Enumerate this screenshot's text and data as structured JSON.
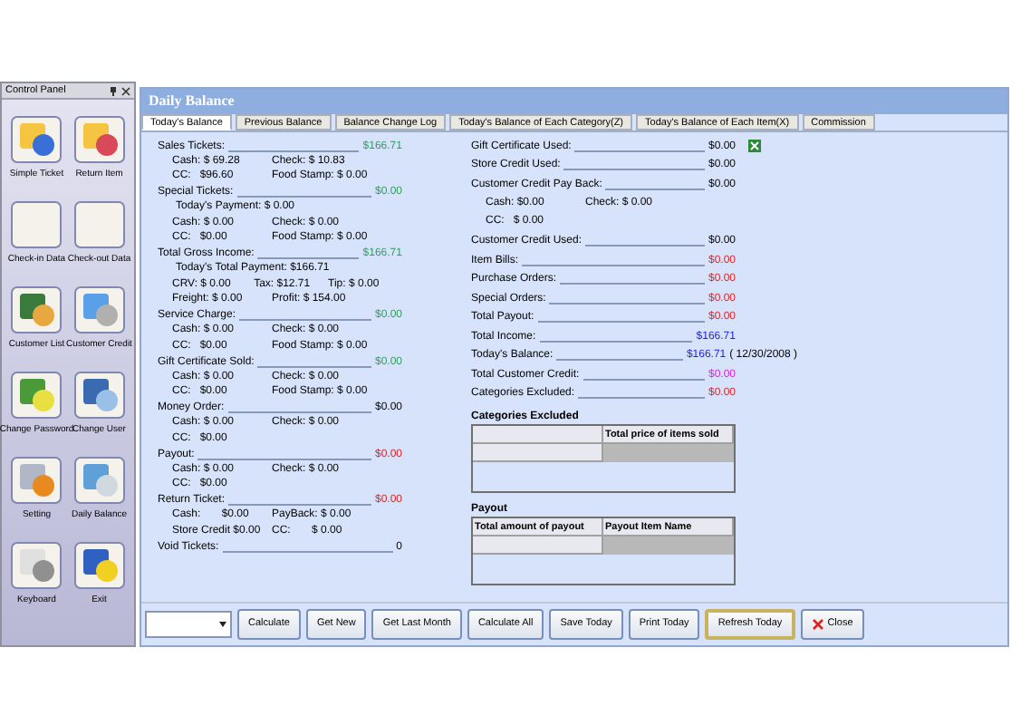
{
  "control_panel": {
    "title": "Control Panel",
    "items": [
      {
        "label": "Simple Ticket"
      },
      {
        "label": "Return Item"
      },
      {
        "label": "Check-in Data"
      },
      {
        "label": "Check-out Data"
      },
      {
        "label": "Customer List"
      },
      {
        "label": "Customer Credit"
      },
      {
        "label": "Change Password"
      },
      {
        "label": "Change User"
      },
      {
        "label": "Setting"
      },
      {
        "label": "Daily Balance"
      },
      {
        "label": "Keyboard"
      },
      {
        "label": "Exit"
      }
    ]
  },
  "window": {
    "title": "Daily Balance"
  },
  "tabs": [
    {
      "label": "Today's Balance",
      "selected": true
    },
    {
      "label": "Previous Balance",
      "selected": false
    },
    {
      "label": "Balance Change Log",
      "selected": false
    },
    {
      "label": "Today's Balance of Each Category(Z)",
      "selected": false
    },
    {
      "label": "Today's Balance of Each Item(X)",
      "selected": false
    },
    {
      "label": "Commission",
      "selected": false
    }
  ],
  "left_column": [
    {
      "kind": "total",
      "label": "Sales Tickets:",
      "value": "$166.71",
      "color": "#2e9e5a"
    },
    {
      "kind": "detail",
      "cells": [
        "Cash: $ 69.28",
        "Check: $ 10.83"
      ]
    },
    {
      "kind": "detail",
      "cells": [
        "CC:   $96.60",
        "Food Stamp: $ 0.00"
      ]
    },
    {
      "kind": "total",
      "label": "Special Tickets:",
      "value": "$0.00",
      "color": "#2e9e5a"
    },
    {
      "kind": "note",
      "text": "Today's Payment: $ 0.00"
    },
    {
      "kind": "detail",
      "cells": [
        "Cash: $ 0.00",
        "Check: $ 0.00"
      ]
    },
    {
      "kind": "detail",
      "cells": [
        "CC:   $0.00",
        "Food Stamp: $ 0.00"
      ]
    },
    {
      "kind": "total",
      "label": "Total Gross Income:",
      "value": "$166.71",
      "color": "#2e9e5a"
    },
    {
      "kind": "note",
      "text": "Today's Total Payment: $166.71"
    },
    {
      "kind": "detail",
      "cells": [
        "CRV: $ 0.00",
        "Tax: $12.71",
        "Tip: $ 0.00"
      ]
    },
    {
      "kind": "detail",
      "cells": [
        "Freight: $ 0.00",
        "Profit: $ 154.00"
      ]
    },
    {
      "kind": "total",
      "label": "Service Charge:",
      "value": "$0.00",
      "color": "#2e9e5a"
    },
    {
      "kind": "detail",
      "cells": [
        "Cash: $ 0.00",
        "Check: $ 0.00"
      ]
    },
    {
      "kind": "detail",
      "cells": [
        "CC:   $0.00",
        "Food Stamp: $ 0.00"
      ]
    },
    {
      "kind": "total",
      "label": "Gift Certificate Sold:",
      "value": "$0.00",
      "color": "#2e9e5a"
    },
    {
      "kind": "detail",
      "cells": [
        "Cash: $ 0.00",
        "Check: $ 0.00"
      ]
    },
    {
      "kind": "detail",
      "cells": [
        "CC:   $0.00",
        "Food Stamp: $ 0.00"
      ]
    },
    {
      "kind": "total",
      "label": "Money Order:",
      "value": "$0.00"
    },
    {
      "kind": "detail",
      "cells": [
        "Cash: $ 0.00",
        "Check: $ 0.00"
      ]
    },
    {
      "kind": "detail",
      "cells": [
        "CC:   $0.00"
      ]
    },
    {
      "kind": "total",
      "label": "Payout:",
      "value": "$0.00",
      "color": "#e02020"
    },
    {
      "kind": "detail",
      "cells": [
        "Cash: $ 0.00",
        "Check: $ 0.00"
      ]
    },
    {
      "kind": "detail",
      "cells": [
        "CC:   $0.00"
      ]
    },
    {
      "kind": "total",
      "label": "Return Ticket:",
      "value": "$0.00",
      "color": "#e02020"
    },
    {
      "kind": "detail",
      "cells": [
        "Cash:       $0.00",
        "PayBack: $ 0.00"
      ]
    },
    {
      "kind": "detail",
      "cells": [
        "Store Credit $0.00",
        "CC:       $ 0.00"
      ]
    },
    {
      "kind": "total",
      "label": "Void Tickets:",
      "value": "0"
    }
  ],
  "right_column": [
    {
      "kind": "total",
      "label": "Gift Certificate Used:",
      "value": "$0.00"
    },
    {
      "kind": "total",
      "label": "Store Credit Used:",
      "value": "$0.00"
    },
    {
      "kind": "total",
      "label": "Customer Credit Pay Back:",
      "value": "$0.00"
    },
    {
      "kind": "detail",
      "cells": [
        "Cash: $0.00",
        "Check: $ 0.00"
      ]
    },
    {
      "kind": "detail",
      "cells": [
        "CC:   $ 0.00"
      ]
    },
    {
      "kind": "total",
      "label": "Customer Credit Used:",
      "value": "$0.00"
    },
    {
      "kind": "total",
      "label": "Item Bills:",
      "value": "$0.00",
      "color": "#e02020"
    },
    {
      "kind": "total",
      "label": "Purchase Orders:",
      "value": "$0.00",
      "color": "#e02020"
    },
    {
      "kind": "total",
      "label": "Special Orders:",
      "value": "$0.00",
      "color": "#e02020"
    },
    {
      "kind": "total",
      "label": "Total Payout:",
      "value": "$0.00",
      "color": "#e02020"
    },
    {
      "kind": "total",
      "label": "Total  Income:",
      "value": "$166.71",
      "color": "#2020ee"
    },
    {
      "kind": "total",
      "label": "Today's Balance:",
      "value": "$166.71",
      "color": "#2020ee",
      "note": "( 12/30/2008 )"
    },
    {
      "kind": "total",
      "label": "Total Customer Credit:",
      "value": "$0.00",
      "color": "#e020e0"
    },
    {
      "kind": "total",
      "label": "Categories Excluded:",
      "value": "$0.00",
      "color": "#e02020"
    }
  ],
  "tables": [
    {
      "title": "Categories Excluded",
      "columns": [
        "",
        "Total price of items sold"
      ]
    },
    {
      "title": "Payout",
      "columns": [
        "Total amount of payout",
        "Payout Item Name"
      ]
    }
  ],
  "buttons": [
    {
      "label": "Calculate",
      "focused": false
    },
    {
      "label": "Get New",
      "focused": false
    },
    {
      "label": "Get Last Month",
      "focused": false
    },
    {
      "label": "Calculate All",
      "focused": false
    },
    {
      "label": "Save Today",
      "focused": false
    },
    {
      "label": "Print Today",
      "focused": false
    },
    {
      "label": "Refresh Today",
      "focused": true
    },
    {
      "label": "Close",
      "focused": false
    }
  ]
}
